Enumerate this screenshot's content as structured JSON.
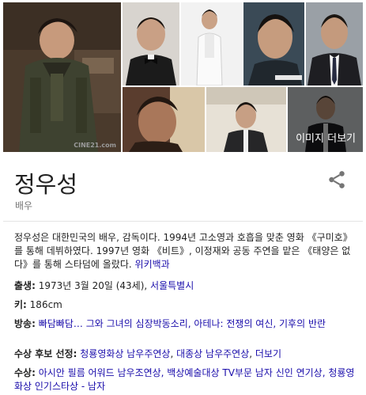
{
  "gallery": {
    "more_images_label": "이미지 더보기",
    "watermark": "CINE21.com",
    "photos": [
      {
        "name": "main-photo",
        "description_icon": "person-photo"
      },
      {
        "name": "photo-bowtie",
        "description_icon": "person-photo"
      },
      {
        "name": "photo-standing",
        "description_icon": "person-photo"
      },
      {
        "name": "photo-closeup",
        "description_icon": "person-photo"
      },
      {
        "name": "photo-suit-tie",
        "description_icon": "person-photo"
      },
      {
        "name": "photo-film-still",
        "description_icon": "person-photo"
      },
      {
        "name": "photo-event",
        "description_icon": "person-photo"
      },
      {
        "name": "photo-formal",
        "description_icon": "person-photo"
      }
    ]
  },
  "entity": {
    "name": "정우성",
    "type": "배우",
    "share_icon": "share-icon"
  },
  "description": {
    "text": "정우성은 대한민국의 배우, 감독이다. 1994년 고소영과 호흡을 맞춘 영화 《구미호》를 통해 데뷔하였다. 1997년 영화 《비트》, 이정재와 공동 주연을 맡은 《태양은 없다》를 통해 스타덤에 올랐다.",
    "source_link": "위키백과"
  },
  "facts": {
    "birth": {
      "label": "출생:",
      "value": "1973년 3월 20일 (43세),",
      "link": "서울특별시"
    },
    "height": {
      "label": "키:",
      "value": "186cm"
    },
    "broadcast": {
      "label": "방송:",
      "link": "빠담빠담… 그와 그녀의 심장박동소리, 아테나: 전쟁의 여신, 기후의 반란"
    },
    "nominations": {
      "label": "수상 후보 선정:",
      "links": [
        "청룡영화상 남우주연상",
        "대종상 남우주연상"
      ],
      "more": "더보기"
    },
    "awards": {
      "label": "수상:",
      "link": "아시안 필름 어워드 남우조연상, 백상예술대상 TV부문 남자 신인 연기상, 청룡영화상 인기스타상 - 남자"
    }
  },
  "colors": {
    "link": "#1a0dab",
    "text": "#222222",
    "muted": "#777777"
  }
}
